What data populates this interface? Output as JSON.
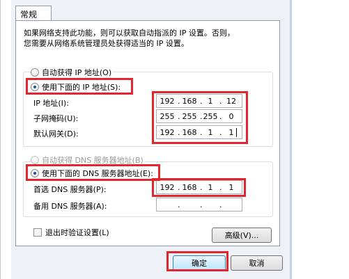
{
  "tab": {
    "label": "常规"
  },
  "description": {
    "line1": "如果网络支持此功能，则可以获取自动指派的 IP 设置。否则，",
    "line2": "您需要从网络系统管理员处获得适当的 IP 设置。"
  },
  "ip": {
    "auto_label": "自动获得 IP 地址(O)",
    "manual_label": "使用下面的 IP 地址(S):",
    "address_label": "IP 地址(I):",
    "subnet_label": "子网掩码(U):",
    "gateway_label": "默认网关(D):",
    "address": [
      "192",
      "168",
      "1",
      "12"
    ],
    "subnet": [
      "255",
      "255",
      "255",
      "0"
    ],
    "gateway": [
      "192",
      "168",
      "1",
      "1"
    ]
  },
  "dns": {
    "auto_label": "自动获得 DNS 服务器地址(B)",
    "manual_label": "使用下面的 DNS 服务器地址(E):",
    "preferred_label": "首选 DNS 服务器(P):",
    "alternate_label": "备用 DNS 服务器(A):",
    "preferred": [
      "192",
      "168",
      "1",
      "1"
    ],
    "alternate": [
      "",
      "",
      "",
      ""
    ]
  },
  "validate_label": "退出时验证设置(L)",
  "advanced_label": "高级(V)...",
  "ok_label": "确定",
  "cancel_label": "取消",
  "dot": ".",
  "colors": {
    "highlight": "#e3262d",
    "dialog_bg": "#eef1f5",
    "panel_border": "#8e9bab"
  }
}
